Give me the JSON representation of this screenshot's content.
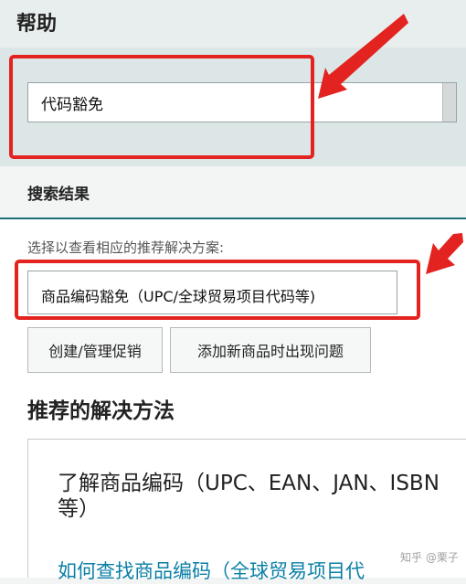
{
  "header": {
    "title": "帮助"
  },
  "search": {
    "value": "代码豁免"
  },
  "results": {
    "title": "搜索结果",
    "instruction": "选择以查看相应的推荐解决方案:",
    "selected": "商品编码豁免（UPC/全球贸易项目代码等)",
    "chips": [
      "创建/管理促销",
      "添加新商品时出现问题"
    ]
  },
  "recommended": {
    "title": "推荐的解决方法",
    "card_title": "了解商品编码（UPC、EAN、JAN、ISBN 等）",
    "card_link": "如何查找商品编码（全球贸易项目代"
  },
  "watermark": "知乎 @栗子",
  "colors": {
    "highlight": "#e3231f",
    "accent": "#1d6f77",
    "link": "#0b7fa6"
  }
}
